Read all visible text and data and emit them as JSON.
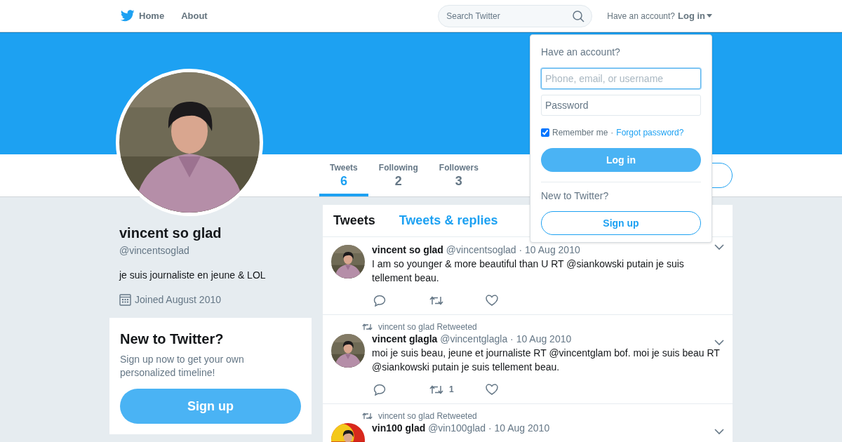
{
  "navbar": {
    "links": [
      {
        "label": "Home",
        "icon": true
      },
      {
        "label": "About",
        "icon": false
      }
    ],
    "search": {
      "placeholder": "Search Twitter"
    },
    "account_prompt": "Have an account?",
    "login_label": "Log in"
  },
  "profile_nav": {
    "stats": [
      {
        "label": "Tweets",
        "value": "6",
        "selected": true
      },
      {
        "label": "Following",
        "value": "2",
        "selected": false
      },
      {
        "label": "Followers",
        "value": "3",
        "selected": false
      }
    ]
  },
  "profile": {
    "name": "vincent so glad",
    "handle": "@vincentsoglad",
    "bio": "je suis journaliste en jeune & LOL",
    "joined": "Joined August 2010"
  },
  "signup_card": {
    "title": "New to Twitter?",
    "text": "Sign up now to get your own personalized timeline!",
    "button": "Sign up"
  },
  "stream": {
    "tabs": [
      {
        "label": "Tweets",
        "selected": true
      },
      {
        "label": "Tweets & replies",
        "selected": false
      }
    ],
    "tweets": [
      {
        "name": "vincent so glad",
        "handle": "@vincentsoglad",
        "date": "· 10 Aug 2010",
        "text": "I am so younger & more beautiful than U  RT @siankowski putain je suis tellement beau."
      },
      {
        "context": "vincent so glad Retweeted",
        "name": "vincent glagla",
        "handle": "@vincentglagla",
        "date": "· 10 Aug 2010",
        "text": "moi je suis beau, jeune  et journaliste RT @vincentglam bof. moi je suis beau RT @siankowski putain je suis tellement beau.",
        "retweet_count": "1"
      },
      {
        "context": "vincent so glad Retweeted",
        "name": "vin100 glad",
        "handle": "@vin100glad",
        "date": "· 10 Aug 2010"
      }
    ]
  },
  "login_dropdown": {
    "title": "Have an account?",
    "username": {
      "placeholder": "Phone, email, or username",
      "focused": true
    },
    "password": {
      "placeholder": "Password",
      "focused": false
    },
    "remember": {
      "label": "Remember me",
      "checked": true
    },
    "separator": "·",
    "forgot": "Forgot password?",
    "login_button": "Log in",
    "signup_prompt": "New to Twitter?",
    "signup_button": "Sign up"
  }
}
